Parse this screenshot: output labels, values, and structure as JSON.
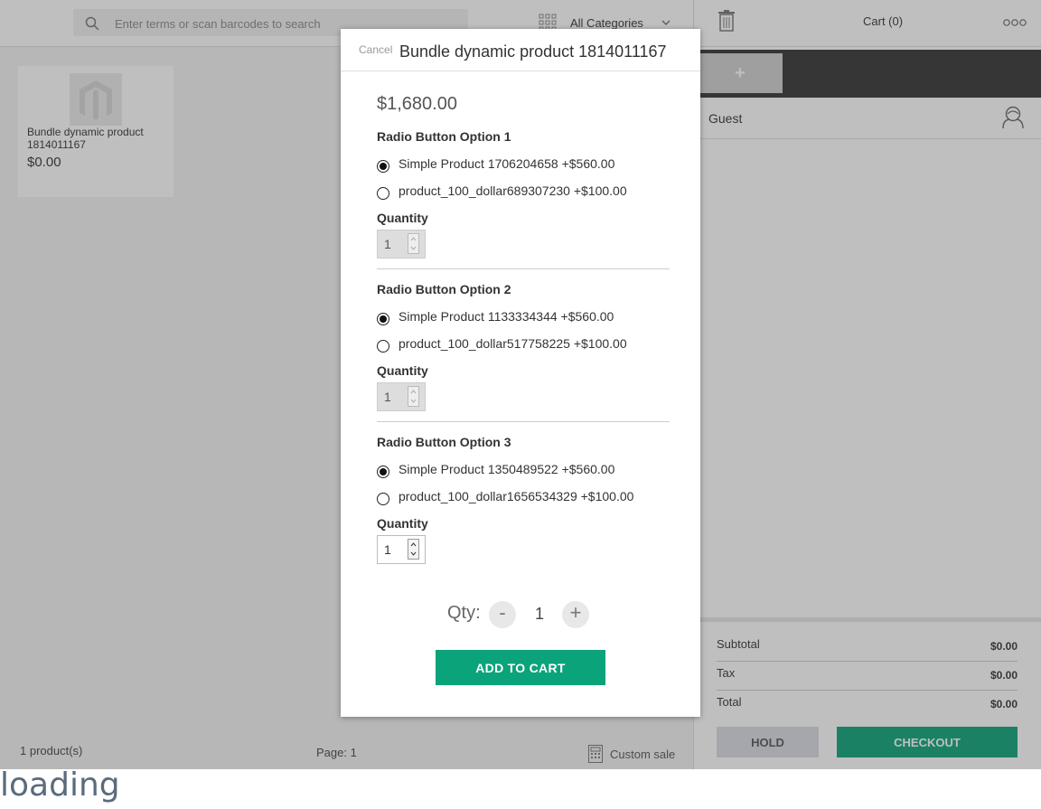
{
  "search": {
    "placeholder": "Enter terms or scan barcodes to search"
  },
  "category": {
    "selected": "All Categories"
  },
  "catalog": {
    "products": [
      {
        "name": "Bundle dynamic product 1814011167",
        "price": "$0.00"
      }
    ],
    "count_text": "1 product(s)",
    "page_text": "Page: 1",
    "custom_sale_label": "Custom sale"
  },
  "cart": {
    "title": "Cart (0)",
    "new_cart_label": "+",
    "customer": "Guest",
    "subtotal_label": "Subtotal",
    "subtotal_value": "$0.00",
    "tax_label": "Tax",
    "tax_value": "$0.00",
    "total_label": "Total",
    "total_value": "$0.00",
    "hold_label": "HOLD",
    "checkout_label": "CHECKOUT"
  },
  "modal": {
    "cancel_label": "Cancel",
    "title": "Bundle dynamic product 1814011167",
    "price": "$1,680.00",
    "quantity_label": "Quantity",
    "options": [
      {
        "title": "Radio Button Option 1",
        "choices": [
          {
            "label": "Simple Product 1706204658  +$560.00",
            "selected": true
          },
          {
            "label": "product_100_dollar689307230  +$100.00",
            "selected": false
          }
        ],
        "quantity": "1",
        "quantity_disabled": true
      },
      {
        "title": "Radio Button Option 2",
        "choices": [
          {
            "label": "Simple Product 1133334344  +$560.00",
            "selected": true
          },
          {
            "label": "product_100_dollar517758225  +$100.00",
            "selected": false
          }
        ],
        "quantity": "1",
        "quantity_disabled": true
      },
      {
        "title": "Radio Button Option 3",
        "choices": [
          {
            "label": "Simple Product 1350489522  +$560.00",
            "selected": true
          },
          {
            "label": "product_100_dollar1656534329  +$100.00",
            "selected": false
          }
        ],
        "quantity": "1",
        "quantity_disabled": false
      }
    ],
    "qty_label": "Qty:",
    "qty_minus": "-",
    "qty_value": "1",
    "qty_plus": "+",
    "add_to_cart_label": "ADD TO CART"
  },
  "loading_text": "loading",
  "colors": {
    "accent": "#0aa37a",
    "dark_bar": "#333333"
  }
}
